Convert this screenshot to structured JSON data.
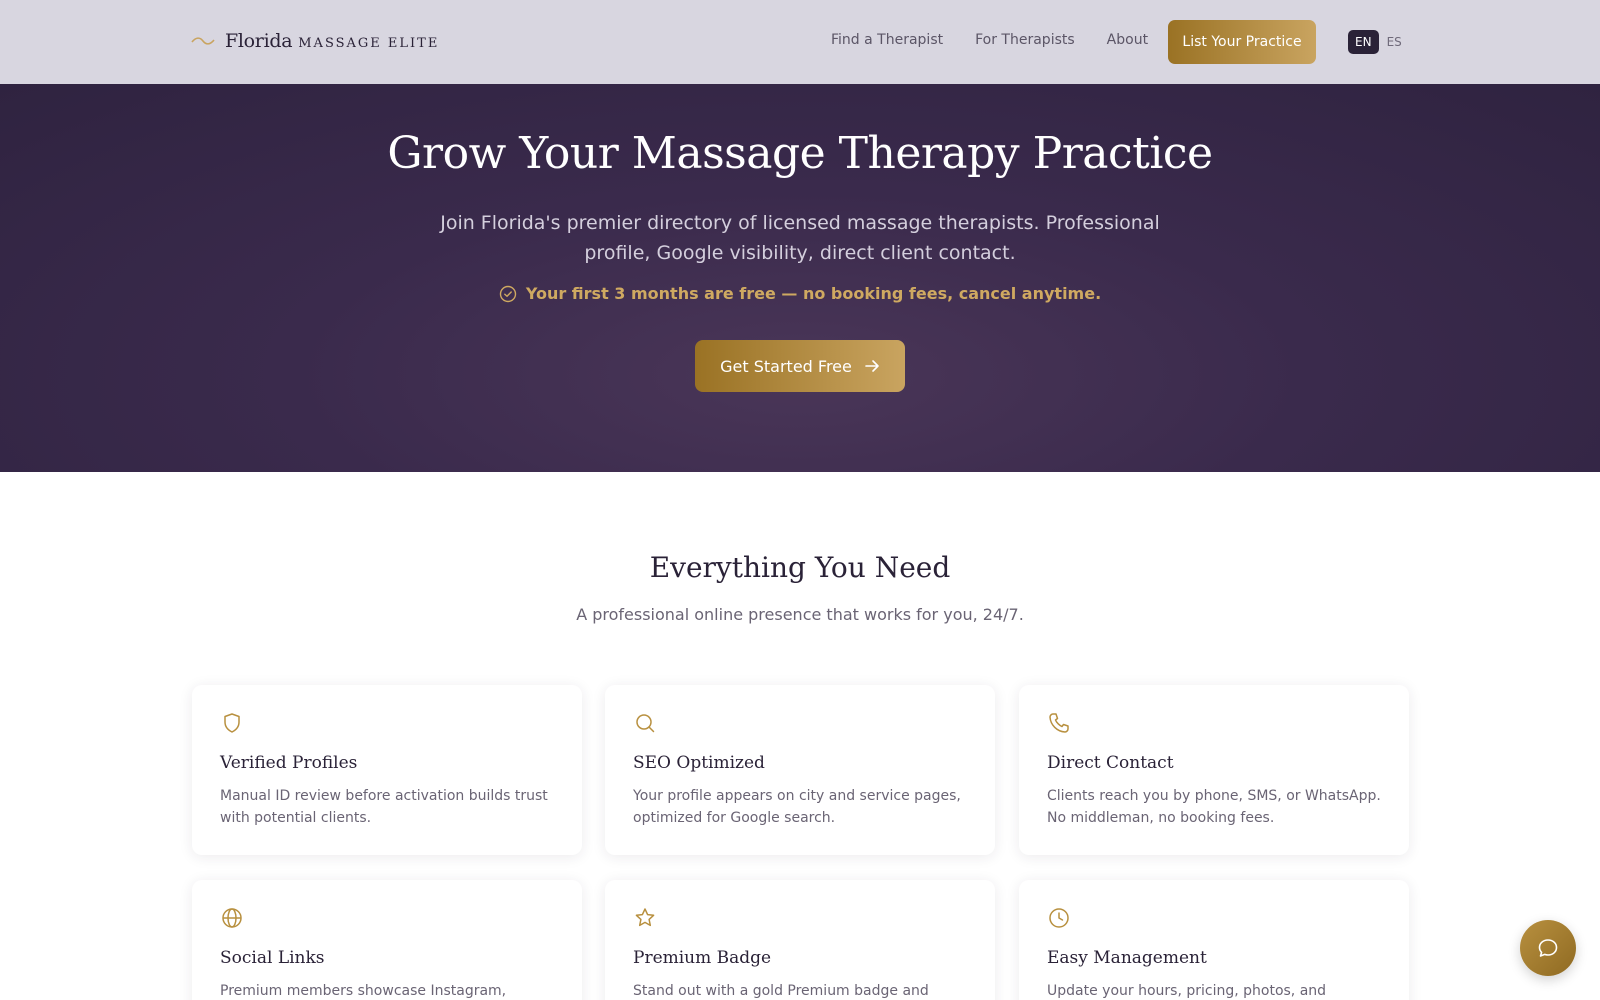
{
  "header": {
    "logo": {
      "brand": "Florida",
      "sub": "MASSAGE ELITE"
    },
    "nav": [
      {
        "label": "Find a Therapist"
      },
      {
        "label": "For Therapists"
      },
      {
        "label": "About"
      }
    ],
    "cta_label": "List Your Practice",
    "lang": {
      "active": "EN",
      "other": "ES"
    }
  },
  "hero": {
    "title": "Grow Your Massage Therapy Practice",
    "subtitle": "Join Florida's premier directory of licensed massage therapists. Professional profile, Google visibility, direct client contact.",
    "promo": "Your first 3 months are free — no booking fees, cancel anytime.",
    "cta_label": "Get Started Free"
  },
  "features": {
    "title": "Everything You Need",
    "subtitle": "A professional online presence that works for you, 24/7.",
    "items": [
      {
        "icon": "shield-icon",
        "title": "Verified Profiles",
        "desc": "Manual ID review before activation builds trust with potential clients."
      },
      {
        "icon": "search-icon",
        "title": "SEO Optimized",
        "desc": "Your profile appears on city and service pages, optimized for Google search."
      },
      {
        "icon": "phone-icon",
        "title": "Direct Contact",
        "desc": "Clients reach you by phone, SMS, or WhatsApp. No middleman, no booking fees."
      },
      {
        "icon": "globe-icon",
        "title": "Social Links",
        "desc": "Premium members showcase Instagram, Facebook,"
      },
      {
        "icon": "star-icon",
        "title": "Premium Badge",
        "desc": "Stand out with a gold Premium badge and priority"
      },
      {
        "icon": "clock-icon",
        "title": "Easy Management",
        "desc": "Update your hours, pricing, photos, and services"
      }
    ]
  },
  "colors": {
    "gold": "#b8903f",
    "hero_bg": "#3a2a4c",
    "nav_bg": "#d8d6e0"
  }
}
